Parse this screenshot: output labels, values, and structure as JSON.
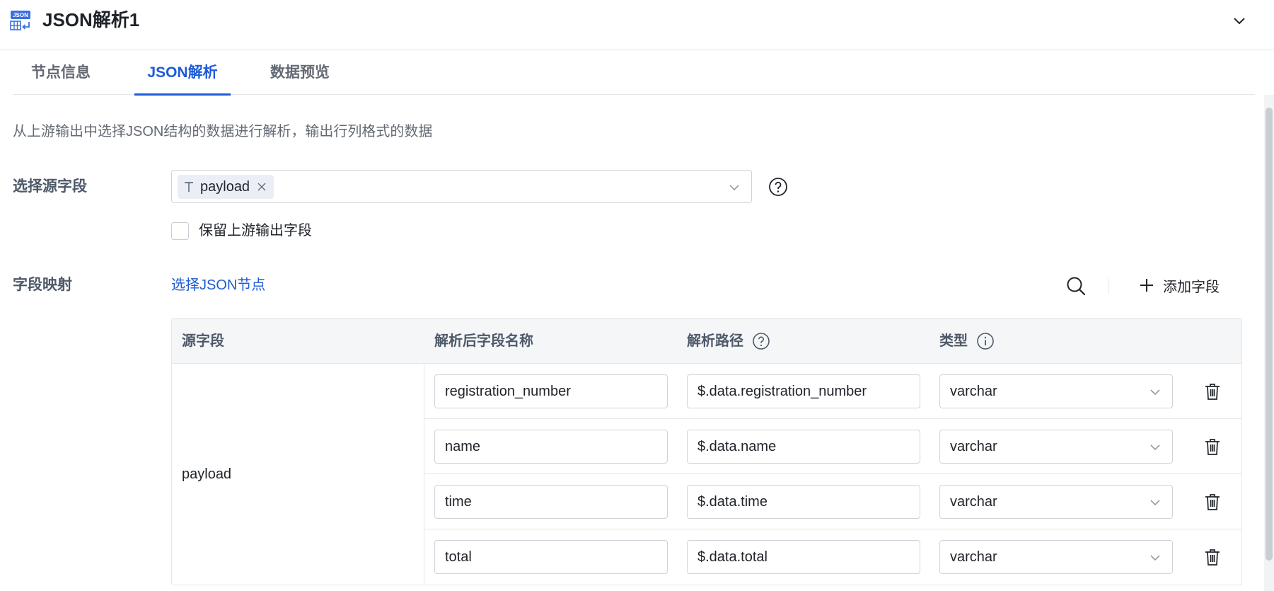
{
  "header": {
    "title": "JSON解析1",
    "logo_icon": "json-table-icon",
    "collapse_icon": "chevron-down-icon"
  },
  "tabs": [
    {
      "label": "节点信息"
    },
    {
      "label": "JSON解析",
      "active": true
    },
    {
      "label": "数据预览"
    }
  ],
  "description": "从上游输出中选择JSON结构的数据进行解析，输出行列格式的数据",
  "source_field": {
    "label": "选择源字段",
    "selected_tag": "payload",
    "tag_icon": "text-type-icon"
  },
  "keep_upstream": {
    "label": "保留上游输出字段",
    "checked": false
  },
  "field_mapping": {
    "label": "字段映射",
    "select_json_node_link": "选择JSON节点",
    "add_field_label": "添加字段"
  },
  "table": {
    "headers": {
      "source": "源字段",
      "name": "解析后字段名称",
      "path": "解析路径",
      "type": "类型"
    },
    "source_value": "payload",
    "rows": [
      {
        "name": "registration_number",
        "path": "$.data.registration_number",
        "type": "varchar"
      },
      {
        "name": "name",
        "path": "$.data.name",
        "type": "varchar"
      },
      {
        "name": "time",
        "path": "$.data.time",
        "type": "varchar"
      },
      {
        "name": "total",
        "path": "$.data.total",
        "type": "varchar"
      }
    ]
  },
  "colors": {
    "accent": "#1d5bd8",
    "text_primary": "#1f2329",
    "text_secondary": "#646a73",
    "border": "#e5e6eb",
    "table_header_bg": "#f5f6f8"
  }
}
